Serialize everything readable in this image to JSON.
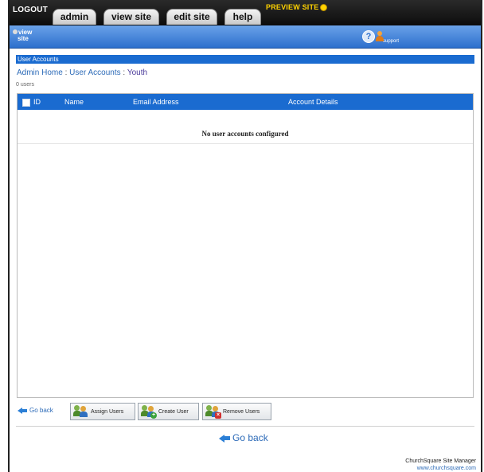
{
  "topbar": {
    "logout": "LOGOUT",
    "tabs": [
      "admin",
      "view site",
      "edit site",
      "help"
    ],
    "preview": "PREVIEW SITE"
  },
  "subbar": {
    "view_site_line1": "view",
    "view_site_line2": "site",
    "support": "support"
  },
  "section": {
    "title": "User Accounts"
  },
  "breadcrumb": {
    "home": "Admin Home",
    "accounts": "User Accounts",
    "current": "Youth",
    "separator": ":"
  },
  "count": "0 users",
  "table": {
    "columns": [
      "ID",
      "Name",
      "Email Address",
      "Account Details"
    ],
    "empty_message": "No user accounts configured"
  },
  "actions": {
    "go_back": "Go back",
    "assign": "Assign Users",
    "create": "Create User",
    "remove": "Remove Users"
  },
  "bottom": {
    "go_back": "Go back"
  },
  "footer": {
    "product": "ChurchSquare Site Manager",
    "url": "www.churchsquare.com"
  },
  "colors": {
    "accent": "#1a6bd0",
    "link": "#2d6bb8",
    "preview": "#ffd200"
  }
}
